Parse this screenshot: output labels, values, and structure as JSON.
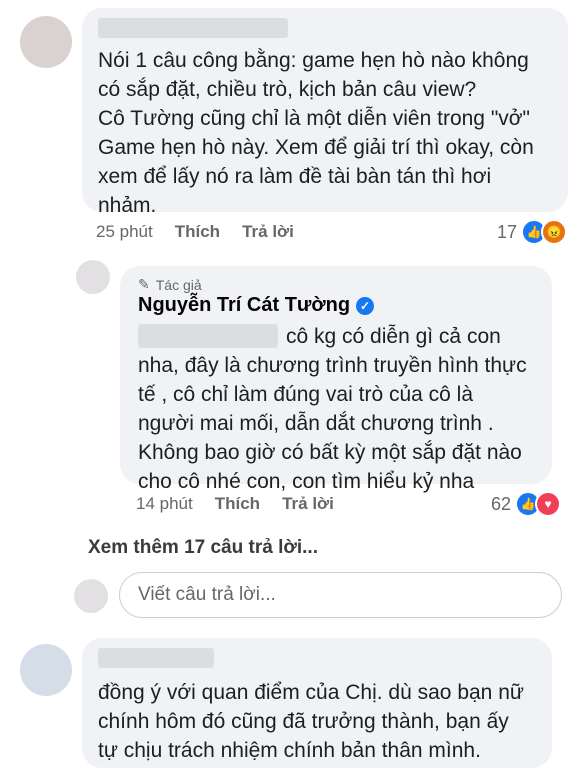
{
  "comment1": {
    "lines": [
      "Nói 1 câu công bằng: game hẹn hò nào không",
      "có sắp đặt, chiều trò, kịch bản câu view?",
      "Cô Tường cũng chỉ là một diễn viên trong \"vở\"",
      "Game hẹn hò này. Xem để giải trí thì okay, còn",
      "xem để lấy nó ra làm đề tài bàn tán thì hơi",
      "nhảm."
    ],
    "time": "25 phút",
    "like_label": "Thích",
    "reply_label": "Trả lời",
    "reaction_count": "17",
    "reactions": [
      "like-icon",
      "angry-icon"
    ]
  },
  "reply": {
    "author_badge": "Tác giả",
    "author_name": "Nguyễn Trí Cát Tường",
    "lines": [
      "cô kg có diễn gì cả con",
      "nha, đây là chương trình truyền hình thực",
      "tế , cô chỉ làm đúng vai trò của cô là",
      "người mai mối, dẫn dắt chương trình .",
      "Không bao giờ có bất kỳ một sắp đặt nào",
      "cho cô nhé con, con tìm hiểu kỷ nha"
    ],
    "time": "14 phút",
    "like_label": "Thích",
    "reply_label": "Trả lời",
    "reaction_count": "62",
    "reactions": [
      "like-icon",
      "love-icon"
    ]
  },
  "view_more": "Xem thêm 17 câu trả lời...",
  "reply_input": {
    "placeholder": "Viết câu trả lời..."
  },
  "comment2": {
    "lines": [
      "đồng ý với quan điểm của Chị. dù sao bạn nữ",
      "chính hôm đó cũng đã trưởng thành, bạn ấy",
      "tự chịu trách nhiệm chính bản thân mình."
    ]
  },
  "colors": {
    "bubble": "#f0f2f5",
    "meta": "#65676b",
    "like": "#1877f2",
    "verified": "#1877f2"
  }
}
